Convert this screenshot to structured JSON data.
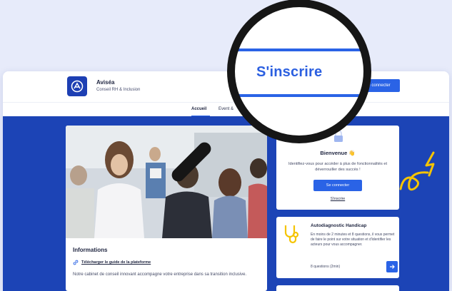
{
  "brand": {
    "name": "Aviséa",
    "subtitle": "Conseil RH & Inclusion",
    "color": "#1d3fb3"
  },
  "header": {
    "connect_label": "e connecter"
  },
  "nav": {
    "items": [
      {
        "label": "Accueil",
        "active": true
      },
      {
        "label": "Event &"
      }
    ]
  },
  "info": {
    "title": "Informations",
    "guide_link": "Télécharger le guide de la plateforme",
    "description": "Notre cabinet de conseil innovant accompagne votre entreprise dans sa transition inclusive."
  },
  "login": {
    "welcome": "Bienvenue 👋",
    "text": "Identifiez-vous pour accéder à plus de fonctionnalités et déverrouiller des succès !",
    "connect_button": "Se connecter",
    "register_link": "S'inscrire"
  },
  "autodiag": {
    "title": "Autodiagnostic Handicap",
    "text": "En moins de 2 minutes et 8 questions, il vous permet de faire le point sur votre situation et d'identifier les acteurs pour vous accompagner.",
    "count": "8 questions (2min)"
  },
  "magnifier": {
    "text": "S'inscrire"
  },
  "colors": {
    "accent": "#2a63e6",
    "hero": "#1c44b6",
    "doodle": "#f5c400",
    "background": "#e7ebfa"
  }
}
